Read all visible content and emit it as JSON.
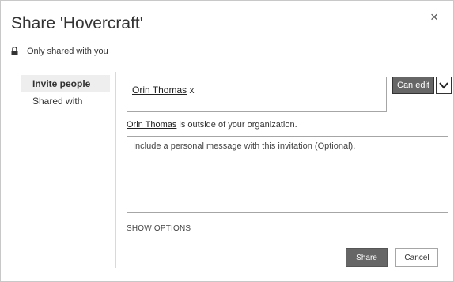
{
  "dialog": {
    "title": "Share 'Hovercraft'",
    "close_label": "×",
    "shared_status": "Only shared with you",
    "icons": {
      "lock": "lock-icon",
      "close": "close-icon",
      "dropdown": "chevron-down-icon"
    }
  },
  "sidebar": {
    "items": [
      {
        "label": "Invite people",
        "active": true
      },
      {
        "label": "Shared with",
        "active": false
      }
    ]
  },
  "invite": {
    "recipient_name": "Orin Thomas",
    "recipient_remove": " x",
    "permission_label": "Can edit",
    "warning_name": "Orin Thomas",
    "warning_text": " is outside of your organization.",
    "message_placeholder": "Include a personal message with this invitation (Optional).",
    "show_options_label": "SHOW OPTIONS"
  },
  "footer": {
    "share_label": "Share",
    "cancel_label": "Cancel"
  },
  "colors": {
    "primary_button": "#666666",
    "border": "#a6a6a6",
    "active_nav_bg": "#eeeeee"
  }
}
